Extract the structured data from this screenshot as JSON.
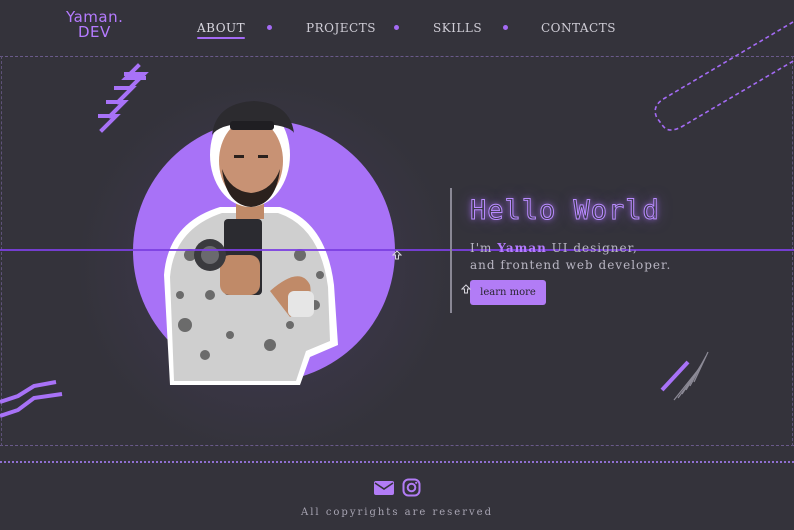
{
  "logo": {
    "line1": "Yaman.",
    "line2": "DEV"
  },
  "nav": {
    "items": [
      {
        "label": "ABOUT",
        "active": true
      },
      {
        "label": "PROJECTS",
        "active": false
      },
      {
        "label": "SKILLS",
        "active": false
      },
      {
        "label": "CONTACTS",
        "active": false
      }
    ]
  },
  "hero": {
    "heading": "Hello World",
    "intro_prefix": "I'm ",
    "intro_name": "Yaman",
    "intro_suffix": " UI designer,",
    "intro_line2": "and frontend web developer.",
    "button_label": "learn more"
  },
  "footer": {
    "icons": [
      "mail-icon",
      "instagram-icon"
    ],
    "copyright": "All copyrights are reserved"
  },
  "colors": {
    "background": "#34333b",
    "accent": "#a872f7",
    "accent_line": "#7b3fe0",
    "text": "#cfcdd6"
  }
}
